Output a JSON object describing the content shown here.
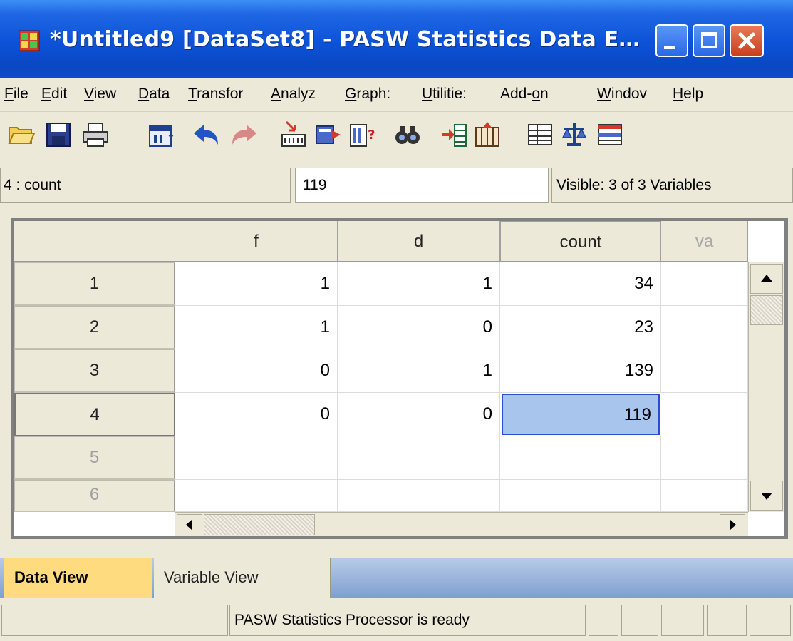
{
  "window": {
    "title": "*Untitled9 [DataSet8] - PASW Statistics Data E…"
  },
  "menu": {
    "items": [
      {
        "pre": "",
        "key": "F",
        "post": "ile"
      },
      {
        "pre": "",
        "key": "E",
        "post": "dit"
      },
      {
        "pre": "",
        "key": "V",
        "post": "iew"
      },
      {
        "pre": "",
        "key": "D",
        "post": "ata"
      },
      {
        "pre": "",
        "key": "T",
        "post": "ransfor"
      },
      {
        "pre": "",
        "key": "A",
        "post": "nalyz"
      },
      {
        "pre": "",
        "key": "G",
        "post": "raph:"
      },
      {
        "pre": "",
        "key": "U",
        "post": "tilitie:"
      },
      {
        "pre": "Add-",
        "key": "o",
        "post": "n"
      },
      {
        "pre": "",
        "key": "W",
        "post": "indov"
      },
      {
        "pre": "",
        "key": "H",
        "post": "elp"
      }
    ]
  },
  "toolbar": {
    "icons": [
      "open-icon",
      "save-icon",
      "print-icon",
      "dialog-recall-icon",
      "undo-icon",
      "redo-icon",
      "goto-case-icon",
      "goto-variable-icon",
      "variables-icon",
      "find-icon",
      "insert-cases-icon",
      "insert-variable-icon",
      "split-file-icon",
      "weight-cases-icon",
      "select-cases-icon"
    ]
  },
  "editor": {
    "cell_ref": "4 : count",
    "cell_value": "119",
    "visible_text": "Visible: 3 of 3 Variables"
  },
  "grid": {
    "columns": [
      "f",
      "d",
      "count",
      "va"
    ],
    "rows": [
      {
        "num": "1",
        "f": "1",
        "d": "1",
        "count": "34"
      },
      {
        "num": "2",
        "f": "1",
        "d": "0",
        "count": "23"
      },
      {
        "num": "3",
        "f": "0",
        "d": "1",
        "count": "139"
      },
      {
        "num": "4",
        "f": "0",
        "d": "0",
        "count": "119"
      },
      {
        "num": "5",
        "f": "",
        "d": "",
        "count": ""
      },
      {
        "num": "6",
        "f": "",
        "d": "",
        "count": ""
      }
    ]
  },
  "tabs": {
    "data_view": "Data View",
    "variable_view": "Variable View"
  },
  "status": {
    "message": "PASW Statistics  Processor is ready"
  }
}
